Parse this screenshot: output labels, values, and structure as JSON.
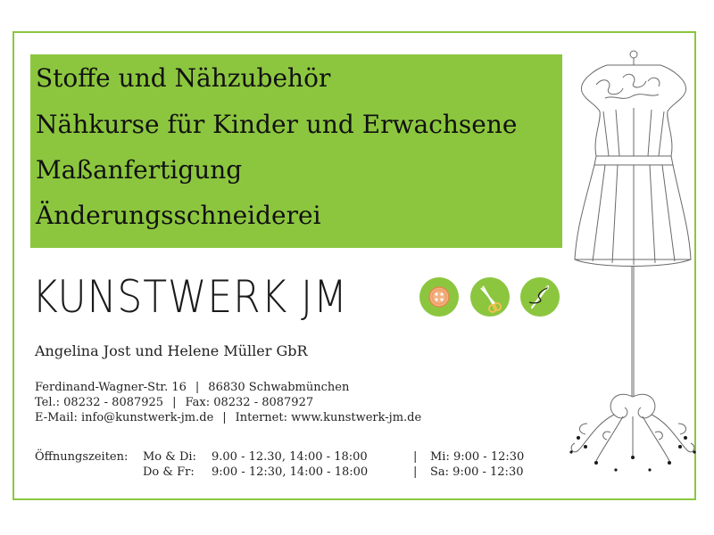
{
  "services": [
    "Stoffe und Nähzubehör",
    "Nähkurse für Kinder und Erwachsene",
    "Maßanfertigung",
    "Änderungsschneiderei"
  ],
  "brand": "KUNSTWERK JM",
  "icons": [
    "button-icon",
    "scissors-icon",
    "needle-thread-icon"
  ],
  "company": "Angelina Jost und Helene Müller GbR",
  "contact": {
    "street": "Ferdinand-Wagner-Str. 16",
    "city": "86830 Schwabmünchen",
    "tel": "Tel.: 08232 - 8087925",
    "fax": "Fax: 08232 - 8087927",
    "email": "E-Mail: info@kunstwerk-jm.de",
    "internet": "Internet: www.kunstwerk-jm.de",
    "separator": "|"
  },
  "hours": {
    "label": "Öffnungszeiten:",
    "row1_days": "Mo  &  Di:",
    "row1_times": "9.00 - 12.30, 14:00 - 18:00",
    "row1_extra": "Mi: 9:00 - 12:30",
    "row2_days": "Do  &  Fr:",
    "row2_times": "9:00 - 12:30, 14:00 - 18:00",
    "row2_extra": "Sa: 9:00 - 12:30"
  },
  "colors": {
    "accent": "#8cc63f",
    "text": "#222222"
  }
}
